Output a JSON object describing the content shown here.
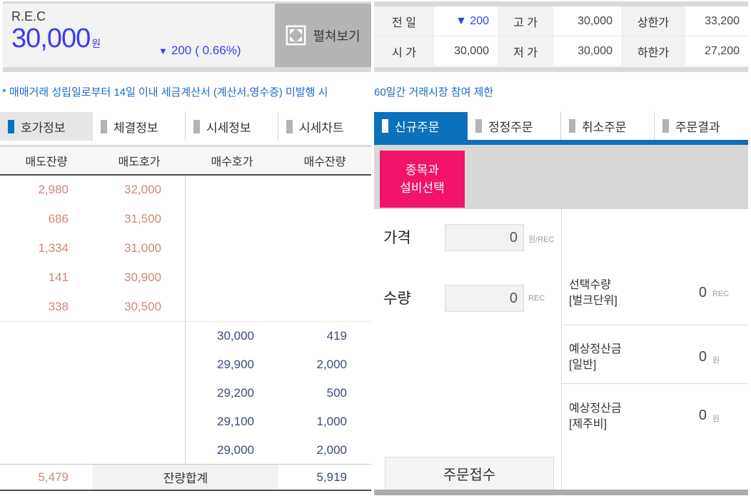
{
  "quote": {
    "name": "R.E.C",
    "price": "30,000",
    "price_unit": "원",
    "change_arrow": "▼",
    "change_value": "200",
    "change_percent": "( 0.66%)",
    "expand_label": "펼쳐보기"
  },
  "summary_table": {
    "rows": [
      [
        {
          "label": "전 일",
          "value": "▼ 200"
        },
        {
          "label": "고 가",
          "value": "30,000"
        },
        {
          "label": "상한가",
          "value": "33,200"
        }
      ],
      [
        {
          "label": "시 가",
          "value": "30,000"
        },
        {
          "label": "저 가",
          "value": "30,000"
        },
        {
          "label": "하한가",
          "value": "27,200"
        }
      ]
    ]
  },
  "notice": {
    "left": "* 매매거래 성립일로부터 14일 이내 세금계산서 (계산서,영수증) 미발행 시",
    "right": "60일간 거래시장 참여 제한"
  },
  "orderbook": {
    "tabs": [
      {
        "label": "호가정보"
      },
      {
        "label": "체결정보"
      },
      {
        "label": "시세정보"
      },
      {
        "label": "시세차트"
      }
    ],
    "headers": [
      "매도잔량",
      "매도호가",
      "매수호가",
      "매수잔량"
    ],
    "asks": [
      {
        "qty": "2,980",
        "price": "32,000"
      },
      {
        "qty": "686",
        "price": "31,500"
      },
      {
        "qty": "1,334",
        "price": "31,000"
      },
      {
        "qty": "141",
        "price": "30,900"
      },
      {
        "qty": "338",
        "price": "30,500"
      }
    ],
    "bids": [
      {
        "price": "30,000",
        "qty": "419"
      },
      {
        "price": "29,900",
        "qty": "2,000"
      },
      {
        "price": "29,200",
        "qty": "500"
      },
      {
        "price": "29,100",
        "qty": "1,000"
      },
      {
        "price": "29,000",
        "qty": "2,000"
      }
    ],
    "total_ask_qty": "5,479",
    "total_label": "잔량합계",
    "total_bid_qty": "5,919"
  },
  "order_panel": {
    "tabs": [
      {
        "label": "신규주문"
      },
      {
        "label": "정정주문"
      },
      {
        "label": "취소주문"
      },
      {
        "label": "주문결과"
      }
    ],
    "select_button_line1": "종목과",
    "select_button_line2": "설비선택",
    "price_label": "가격",
    "price_value": "0",
    "price_unit": "원/REC",
    "qty_label": "수량",
    "qty_value": "0",
    "qty_unit": "REC",
    "info_rows": [
      {
        "label_line1": "선택수량",
        "label_line2": "[벌크단위]",
        "value": "0",
        "unit": "REC"
      },
      {
        "label_line1": "예상정산금",
        "label_line2": "[일반]",
        "value": "0",
        "unit": "원"
      },
      {
        "label_line1": "예상정산금",
        "label_line2": "[제주비]",
        "value": "0",
        "unit": "원"
      }
    ],
    "submit_label": "주문접수"
  },
  "colors": {
    "price_blue": "#3c3cef",
    "notice_blue": "#1b6ac6",
    "tab_active_blue": "#0b71bc",
    "select_pink": "#f2146b",
    "ask_color": "#cf8878",
    "bid_color": "#3d4c78"
  }
}
